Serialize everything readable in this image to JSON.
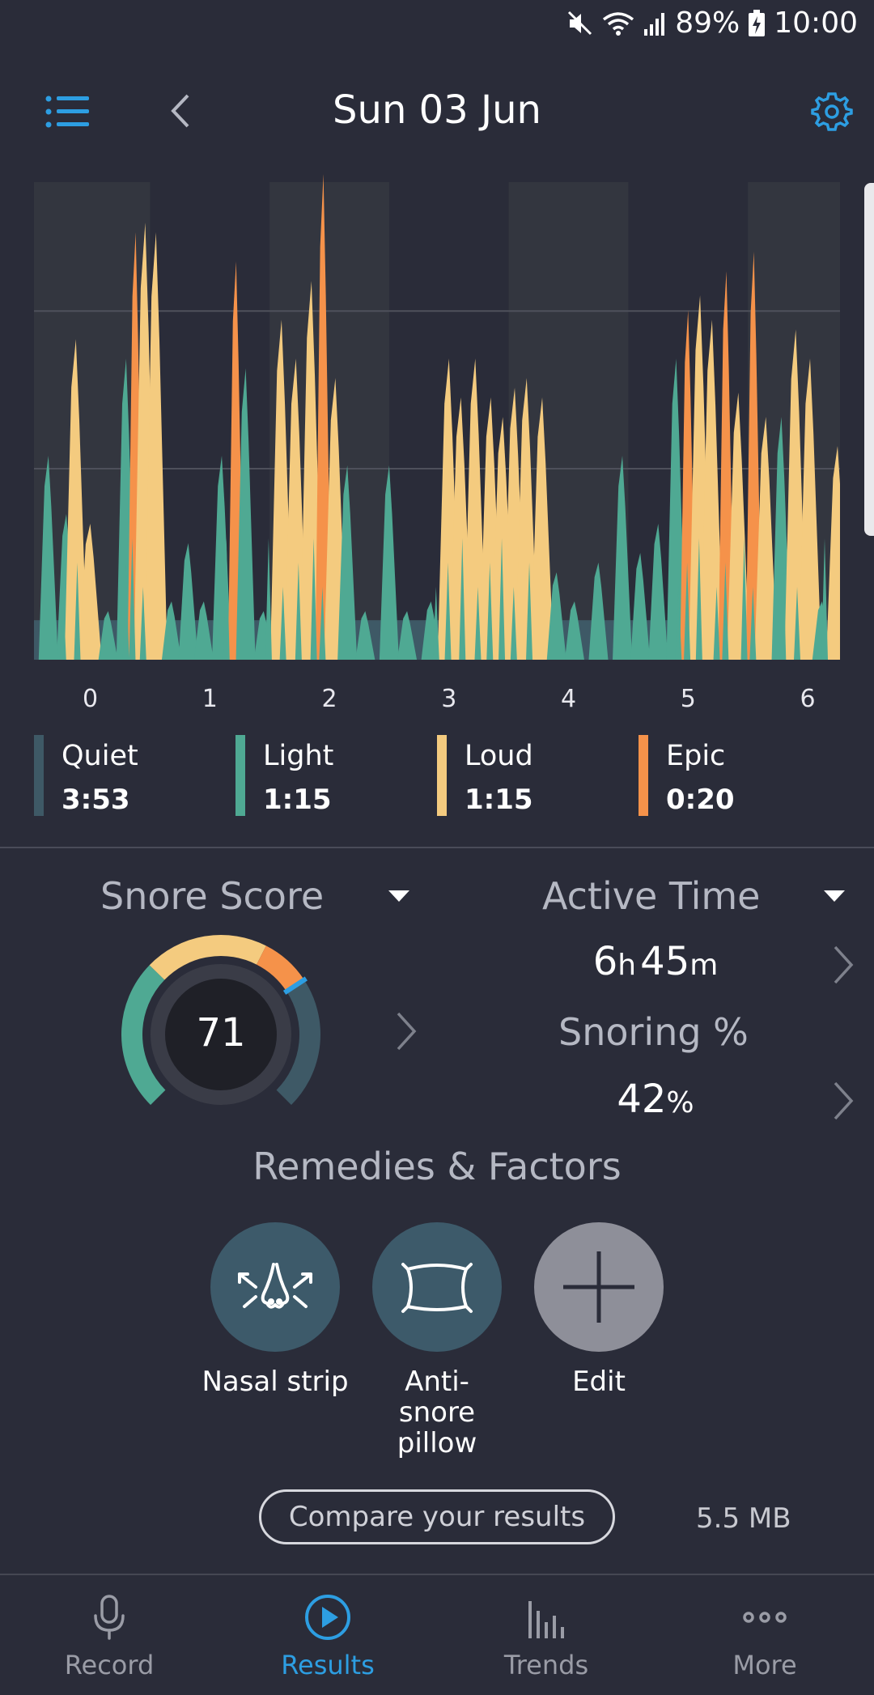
{
  "status_bar": {
    "battery": "89%",
    "time": "10:00"
  },
  "header": {
    "title": "Sun 03 Jun"
  },
  "chart_data": {
    "type": "area",
    "x_ticks": [
      "0",
      "1",
      "2",
      "3",
      "4",
      "5",
      "6"
    ],
    "xlim": [
      -0.45,
      6.25
    ],
    "series": [
      {
        "name": "Quiet",
        "color": "#3e5966"
      },
      {
        "name": "Light",
        "color": "#4fa993"
      },
      {
        "name": "Loud",
        "color": "#f4cb7f"
      },
      {
        "name": "Epic",
        "color": "#f5924a"
      }
    ],
    "peaks": [
      {
        "x": -0.45,
        "y": 0.06,
        "level": "Quiet"
      },
      {
        "x": -0.35,
        "y": 0.42,
        "level": "Light"
      },
      {
        "x": -0.2,
        "y": 0.3,
        "level": "Light"
      },
      {
        "x": -0.12,
        "y": 0.66,
        "level": "Loud"
      },
      {
        "x": 0.0,
        "y": 0.28,
        "level": "Loud"
      },
      {
        "x": 0.15,
        "y": 0.1,
        "level": "Light"
      },
      {
        "x": 0.3,
        "y": 0.62,
        "level": "Light"
      },
      {
        "x": 0.38,
        "y": 0.88,
        "level": "Epic"
      },
      {
        "x": 0.46,
        "y": 0.9,
        "level": "Loud"
      },
      {
        "x": 0.55,
        "y": 0.88,
        "level": "Loud"
      },
      {
        "x": 0.68,
        "y": 0.12,
        "level": "Light"
      },
      {
        "x": 0.82,
        "y": 0.24,
        "level": "Light"
      },
      {
        "x": 0.95,
        "y": 0.12,
        "level": "Light"
      },
      {
        "x": 1.1,
        "y": 0.42,
        "level": "Light"
      },
      {
        "x": 1.22,
        "y": 0.82,
        "level": "Epic"
      },
      {
        "x": 1.3,
        "y": 0.6,
        "level": "Light"
      },
      {
        "x": 1.45,
        "y": 0.1,
        "level": "Light"
      },
      {
        "x": 1.6,
        "y": 0.7,
        "level": "Loud"
      },
      {
        "x": 1.72,
        "y": 0.62,
        "level": "Loud"
      },
      {
        "x": 1.85,
        "y": 0.78,
        "level": "Loud"
      },
      {
        "x": 1.95,
        "y": 1.0,
        "level": "Epic"
      },
      {
        "x": 2.05,
        "y": 0.58,
        "level": "Loud"
      },
      {
        "x": 2.15,
        "y": 0.4,
        "level": "Light"
      },
      {
        "x": 2.3,
        "y": 0.1,
        "level": "Light"
      },
      {
        "x": 2.5,
        "y": 0.4,
        "level": "Light"
      },
      {
        "x": 2.65,
        "y": 0.1,
        "level": "Light"
      },
      {
        "x": 2.85,
        "y": 0.12,
        "level": "Light"
      },
      {
        "x": 3.0,
        "y": 0.62,
        "level": "Loud"
      },
      {
        "x": 3.1,
        "y": 0.54,
        "level": "Loud"
      },
      {
        "x": 3.22,
        "y": 0.62,
        "level": "Loud"
      },
      {
        "x": 3.35,
        "y": 0.54,
        "level": "Loud"
      },
      {
        "x": 3.45,
        "y": 0.5,
        "level": "Loud"
      },
      {
        "x": 3.55,
        "y": 0.56,
        "level": "Loud"
      },
      {
        "x": 3.65,
        "y": 0.58,
        "level": "Loud"
      },
      {
        "x": 3.78,
        "y": 0.54,
        "level": "Loud"
      },
      {
        "x": 3.9,
        "y": 0.18,
        "level": "Light"
      },
      {
        "x": 4.05,
        "y": 0.12,
        "level": "Light"
      },
      {
        "x": 4.25,
        "y": 0.2,
        "level": "Light"
      },
      {
        "x": 4.45,
        "y": 0.42,
        "level": "Light"
      },
      {
        "x": 4.6,
        "y": 0.22,
        "level": "Light"
      },
      {
        "x": 4.75,
        "y": 0.28,
        "level": "Light"
      },
      {
        "x": 4.9,
        "y": 0.62,
        "level": "Light"
      },
      {
        "x": 5.0,
        "y": 0.72,
        "level": "Epic"
      },
      {
        "x": 5.1,
        "y": 0.75,
        "level": "Loud"
      },
      {
        "x": 5.2,
        "y": 0.7,
        "level": "Loud"
      },
      {
        "x": 5.32,
        "y": 0.8,
        "level": "Epic"
      },
      {
        "x": 5.42,
        "y": 0.55,
        "level": "Loud"
      },
      {
        "x": 5.55,
        "y": 0.84,
        "level": "Epic"
      },
      {
        "x": 5.65,
        "y": 0.5,
        "level": "Loud"
      },
      {
        "x": 5.78,
        "y": 0.5,
        "level": "Light"
      },
      {
        "x": 5.9,
        "y": 0.68,
        "level": "Loud"
      },
      {
        "x": 6.02,
        "y": 0.62,
        "level": "Loud"
      },
      {
        "x": 6.12,
        "y": 0.12,
        "level": "Light"
      },
      {
        "x": 6.25,
        "y": 0.44,
        "level": "Loud"
      }
    ],
    "quiet_floor": 0.08
  },
  "legend": [
    {
      "label": "Quiet",
      "value": "3:53",
      "color": "#3e5966"
    },
    {
      "label": "Light",
      "value": "1:15",
      "color": "#4fa993"
    },
    {
      "label": "Loud",
      "value": "1:15",
      "color": "#f4cb7f"
    },
    {
      "label": "Epic",
      "value": "0:20",
      "color": "#f5924a"
    }
  ],
  "snore_score": {
    "label": "Snore Score",
    "value": "71",
    "gauge_fraction": 0.71
  },
  "active_time": {
    "label": "Active Time",
    "hours": "6",
    "h_unit": "h",
    "minutes": "45",
    "m_unit": "m"
  },
  "snoring_percent": {
    "label": "Snoring %",
    "value": "42",
    "unit": "%"
  },
  "remedies": {
    "title": "Remedies & Factors",
    "items": [
      {
        "label": "Nasal strip",
        "icon": "nasal-strip-icon"
      },
      {
        "label": "Anti-snore pillow",
        "icon": "pillow-icon"
      },
      {
        "label": "Edit",
        "icon": "plus-icon"
      }
    ]
  },
  "compare": {
    "label": "Compare your results",
    "size": "5.5 MB"
  },
  "nav": [
    {
      "label": "Record",
      "icon": "microphone-icon",
      "active": false
    },
    {
      "label": "Results",
      "icon": "play-icon",
      "active": true,
      "color": "#2d9ee2"
    },
    {
      "label": "Trends",
      "icon": "bar-chart-icon",
      "active": false
    },
    {
      "label": "More",
      "icon": "more-dots-icon",
      "active": false
    }
  ]
}
